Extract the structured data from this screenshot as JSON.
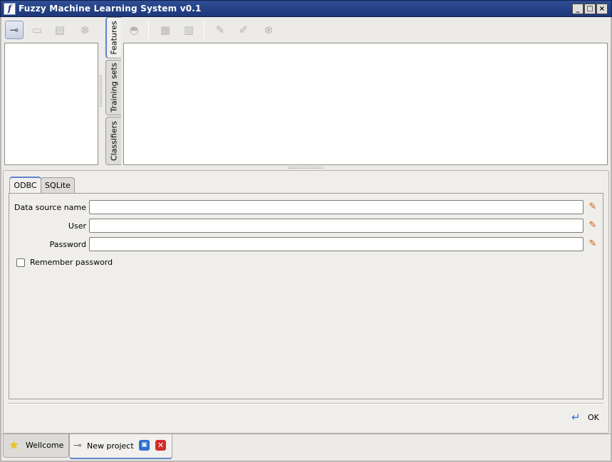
{
  "window": {
    "title": "Fuzzy Machine Learning System v0.1",
    "app_icon": "f",
    "minimize": "_",
    "maximize": "□",
    "close": "×"
  },
  "left_toolbar": {
    "icons": [
      "connect-icon",
      "add-project-icon",
      "add-item-icon",
      "delete-icon"
    ]
  },
  "vertical_tabs": [
    "Features",
    "Training sets",
    "Classifiers"
  ],
  "feature_toolbar": {
    "icons": [
      "feature-icon",
      "feature-add-icon",
      "feature-import-icon",
      "edit-icon",
      "brush-icon",
      "cancel-icon"
    ]
  },
  "db_tabs": [
    "ODBC",
    "SQLite"
  ],
  "form": {
    "dsn_label": "Data source name",
    "user_label": "User",
    "password_label": "Password",
    "dsn_value": "",
    "user_value": "",
    "password_value": "",
    "remember_label": "Remember password",
    "remember_checked": false
  },
  "ok_label": "OK",
  "bottom_tabs": [
    {
      "label": "Wellcome",
      "icon": "star-icon"
    },
    {
      "label": "New project",
      "icon": "plug-icon"
    }
  ],
  "colors": {
    "title_bar": "#2f4e93",
    "tab_accent": "#5f83c7",
    "close_tab": "#d22a2a",
    "restore_tab": "#2e6fd0"
  }
}
